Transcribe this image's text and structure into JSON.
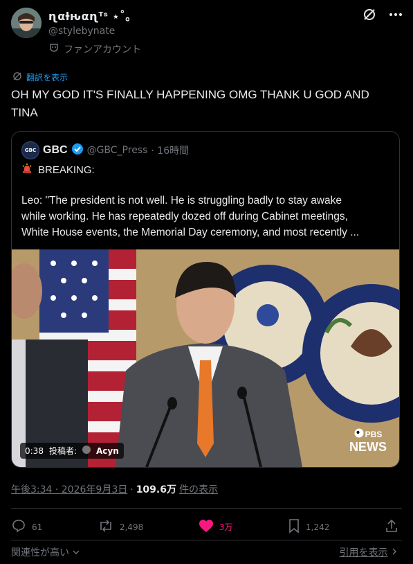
{
  "author": {
    "display_name": "ɳαƚԋαɳᵀˢ ⋆˚｡",
    "handle": "@stylebynate",
    "badge": "ファンアカウント"
  },
  "translate_label": "翻訳を表示",
  "tweet_text": "OH MY GOD IT'S FINALLY HAPPENING OMG THANK U GOD AND TINA",
  "quote": {
    "avatar_text": "GBC",
    "name": "GBC",
    "handle": "@GBC_Press",
    "time": "· 16時間",
    "breaking": "BREAKING:",
    "body_lines": [
      "Leo: \"The president is not well. He is struggling badly to stay awake",
      "while working. He has repeatedly dozed off during Cabinet meetings,",
      "White House events, the Memorial Day ceremony, and most recently ..."
    ],
    "video": {
      "duration": "0:38",
      "poster_label": "投稿者:",
      "poster_name": "Acyn",
      "watermark_top": "PBS",
      "watermark_bottom": "NEWS"
    }
  },
  "meta": {
    "timestamp": "午後3:34 · 2026年9月3日",
    "sep": "·",
    "views": "109.6万",
    "views_label": "件の表示"
  },
  "stats": {
    "replies": "61",
    "reposts": "2,498",
    "likes": "3万",
    "bookmarks": "1,242"
  },
  "footer": {
    "left": "関連性が高い",
    "right": "引用を表示"
  },
  "colors": {
    "accent": "#1d9bf0",
    "like": "#f91880",
    "verified": "#1d9bf0"
  }
}
